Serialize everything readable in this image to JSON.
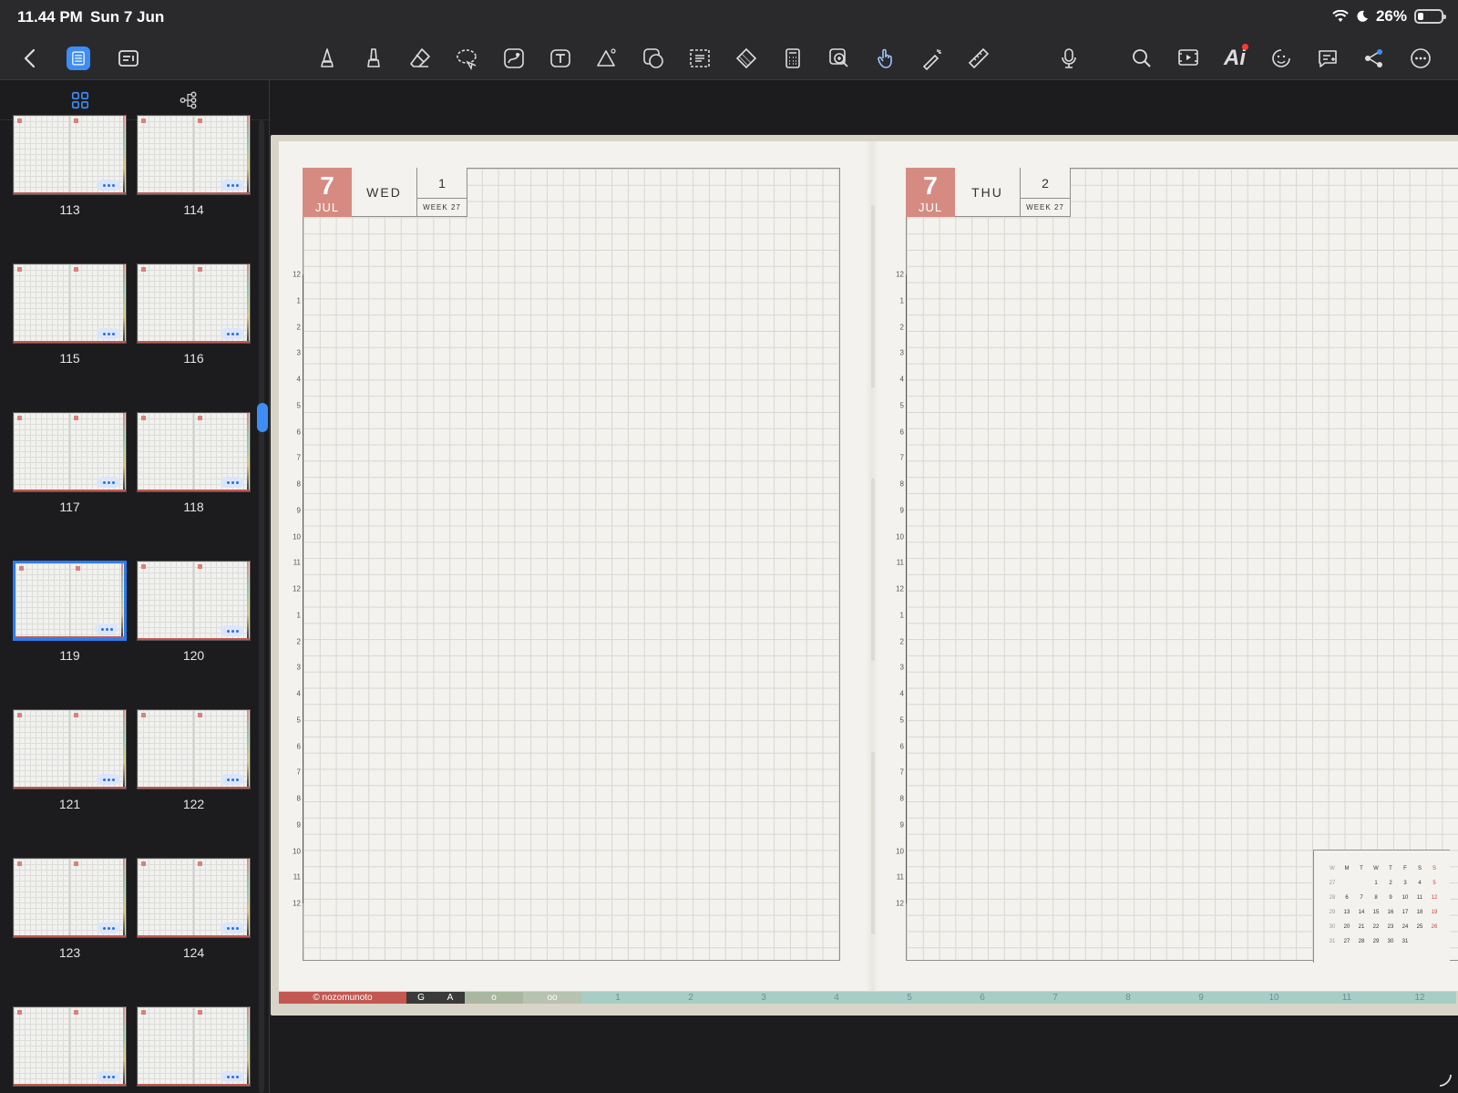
{
  "status_bar": {
    "time": "11.44 PM",
    "date": "Sun 7 Jun",
    "battery": "26%",
    "battery_level": 0.26
  },
  "toolbar": {
    "left": [
      "back-icon",
      "page-view-icon",
      "outline-icon"
    ],
    "tools": [
      "pen-icon",
      "highlighter-icon",
      "eraser-icon",
      "lasso-icon",
      "image-icon",
      "text-icon",
      "shape-icon",
      "sticker-icon",
      "selection-icon",
      "tape-icon",
      "calculator-icon",
      "zoom-window-icon",
      "hand-icon",
      "laser-pointer-icon",
      "ruler-icon"
    ],
    "right": [
      "microphone-icon",
      "search-icon",
      "presentation-icon",
      "ai-icon",
      "emoji-icon",
      "comment-icon",
      "share-icon",
      "more-icon"
    ],
    "ai_label": "Ai"
  },
  "sidebar": {
    "tabs": [
      "grid-view-icon",
      "outline-tree-icon"
    ],
    "pages": [
      "113",
      "114",
      "115",
      "116",
      "117",
      "118",
      "119",
      "120",
      "121",
      "122",
      "123",
      "124",
      "",
      ""
    ],
    "selected_page": "119"
  },
  "left_page": {
    "day_num": "7",
    "month": "JUL",
    "weekday": "WED",
    "date": "1",
    "week": "WEEK 27"
  },
  "right_page": {
    "day_num": "7",
    "month": "JUL",
    "weekday": "THU",
    "date": "2",
    "week": "WEEK 27"
  },
  "timeline_hours": [
    "12",
    "1",
    "2",
    "3",
    "4",
    "5",
    "6",
    "7",
    "8",
    "9",
    "10",
    "11",
    "12",
    "1",
    "2",
    "3",
    "4",
    "5",
    "6",
    "7",
    "8",
    "9",
    "10",
    "11",
    "12"
  ],
  "mini_calendar": {
    "header": [
      "W",
      "M",
      "T",
      "W",
      "T",
      "F",
      "S",
      "S"
    ],
    "rows": [
      [
        "27",
        "",
        "",
        "1",
        "2",
        "3",
        "4",
        "5"
      ],
      [
        "28",
        "6",
        "7",
        "8",
        "9",
        "10",
        "11",
        "12"
      ],
      [
        "29",
        "13",
        "14",
        "15",
        "16",
        "17",
        "18",
        "19"
      ],
      [
        "30",
        "20",
        "21",
        "22",
        "23",
        "24",
        "25",
        "26"
      ],
      [
        "31",
        "27",
        "28",
        "29",
        "30",
        "31",
        "",
        ""
      ]
    ]
  },
  "footer_tabs": {
    "brand": "© nozomunoto",
    "letters": [
      "G",
      "A"
    ],
    "circles": [
      "o",
      "oo"
    ],
    "months": [
      "1",
      "2",
      "3",
      "4",
      "5",
      "6",
      "7",
      "8",
      "9",
      "10",
      "11",
      "12"
    ]
  },
  "colors": {
    "accent": "#3d8df5",
    "date_tag": "#d68b82",
    "brand_tab": "#c35852",
    "month_tabs": "#a8ccc6"
  }
}
